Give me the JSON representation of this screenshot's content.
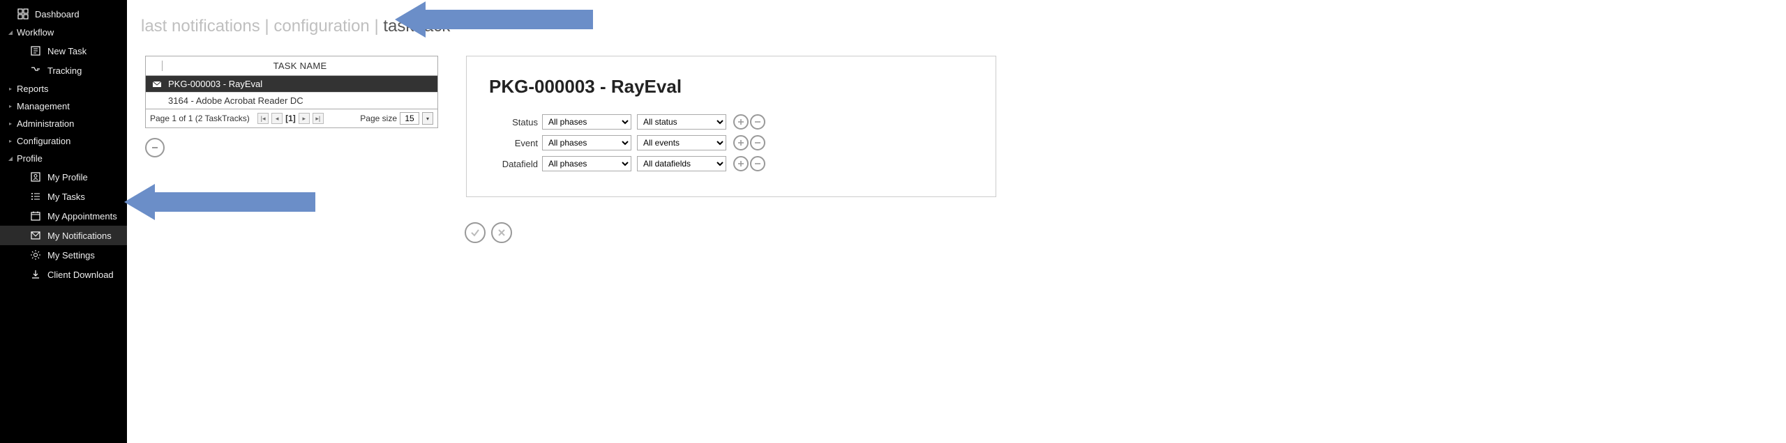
{
  "sidebar": {
    "items": [
      {
        "label": "Dashboard",
        "icon": "dashboard-icon",
        "type": "top"
      },
      {
        "label": "Workflow",
        "icon": null,
        "type": "group"
      },
      {
        "label": "New Task",
        "icon": "newtask-icon",
        "type": "sub"
      },
      {
        "label": "Tracking",
        "icon": "tracking-icon",
        "type": "sub"
      },
      {
        "label": "Reports",
        "icon": null,
        "type": "group"
      },
      {
        "label": "Management",
        "icon": null,
        "type": "group"
      },
      {
        "label": "Administration",
        "icon": null,
        "type": "group"
      },
      {
        "label": "Configuration",
        "icon": null,
        "type": "group"
      },
      {
        "label": "Profile",
        "icon": null,
        "type": "group"
      },
      {
        "label": "My Profile",
        "icon": "profile-icon",
        "type": "sub"
      },
      {
        "label": "My Tasks",
        "icon": "tasks-icon",
        "type": "sub"
      },
      {
        "label": "My Appointments",
        "icon": "appointments-icon",
        "type": "sub"
      },
      {
        "label": "My Notifications",
        "icon": "notifications-icon",
        "type": "sub",
        "selected": true
      },
      {
        "label": "My Settings",
        "icon": "settings-icon",
        "type": "sub"
      },
      {
        "label": "Client Download",
        "icon": "download-icon",
        "type": "sub"
      }
    ]
  },
  "breadcrumb": {
    "part1": "last notifications",
    "sep": " | ",
    "part2": "configuration",
    "part3": "tasktrack"
  },
  "table": {
    "header": "TASK NAME",
    "rows": [
      {
        "label": "PKG-000003 - RayEval",
        "selected": true,
        "icon": true
      },
      {
        "label": "3164 - Adobe Acrobat Reader DC",
        "selected": false,
        "icon": false
      }
    ],
    "pager_text": "Page 1 of 1 (2 TaskTracks)",
    "current_page": "[1]",
    "page_size_label": "Page size",
    "page_size_value": "15"
  },
  "detail": {
    "title": "PKG-000003 - RayEval",
    "filters": [
      {
        "label": "Status",
        "sel1": "All phases",
        "sel2": "All status"
      },
      {
        "label": "Event",
        "sel1": "All phases",
        "sel2": "All events"
      },
      {
        "label": "Datafield",
        "sel1": "All phases",
        "sel2": "All datafields"
      }
    ]
  }
}
